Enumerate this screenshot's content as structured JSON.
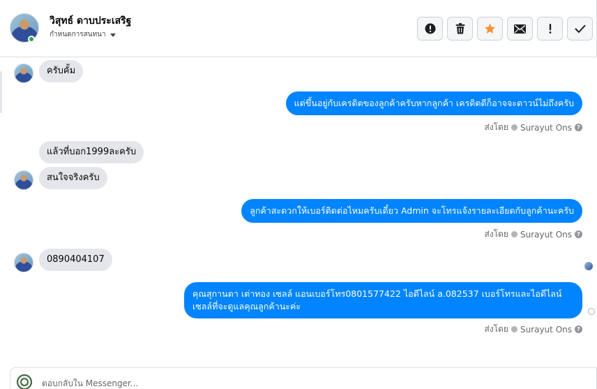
{
  "header": {
    "contact_name": "วิสุทธ์ ดาบประเสริฐ",
    "assign_label": "กำหนดการสนทนา"
  },
  "actions": [
    {
      "name": "report-button",
      "icon": "alert-circle-icon"
    },
    {
      "name": "delete-button",
      "icon": "trash-icon"
    },
    {
      "name": "star-button",
      "icon": "star-icon",
      "color": "#f7923a"
    },
    {
      "name": "mark-unread-button",
      "icon": "envelope-icon"
    },
    {
      "name": "important-button",
      "icon": "exclamation-icon"
    },
    {
      "name": "mark-done-button",
      "icon": "checkmark-icon"
    }
  ],
  "messages": [
    {
      "direction": "incoming",
      "text": "ครับคั้ม"
    },
    {
      "direction": "outgoing",
      "text": "แต่ขึ้นอยู่กับเครดิตของลูกค้าครับหากลูกค้า เครดิตดีก็อาจจะดาวน์ไม่ถึงครับ",
      "sent_by_label": "ส่งโดย",
      "sender": "Surayut Ons"
    },
    {
      "direction": "incoming",
      "text": "แล้วที่บอก1999ละครับ"
    },
    {
      "direction": "incoming",
      "text": "สนใจจริงครับ"
    },
    {
      "direction": "outgoing",
      "text": "ลูกค้าสะดวกให้เบอร์ติดต่อไหมครับเดี๋ยว Admin จะโทรแจ้งรายละเอียดกับลูกค้านะครับ",
      "sent_by_label": "ส่งโดย",
      "sender": "Surayut Ons"
    },
    {
      "direction": "incoming",
      "text": "0890404107"
    },
    {
      "direction": "outgoing",
      "text": "คุณสุกานดา เต่าทอง  เซลล์ แอนเบอร์โทร0801577422 ไอดีไลน์ a.082537  เบอร์โทรและไอดีไลน์เซลล์ที่จะดูแลคุณลูกค้านะค่ะ",
      "sent_by_label": "ส่งโดย",
      "sender": "Surayut Ons"
    }
  ],
  "composer": {
    "placeholder": "ตอบกลับใน Messenger..."
  },
  "colors": {
    "outgoing_bubble": "#0084ff",
    "incoming_bubble": "#e4e6eb",
    "online": "#31a24c"
  }
}
